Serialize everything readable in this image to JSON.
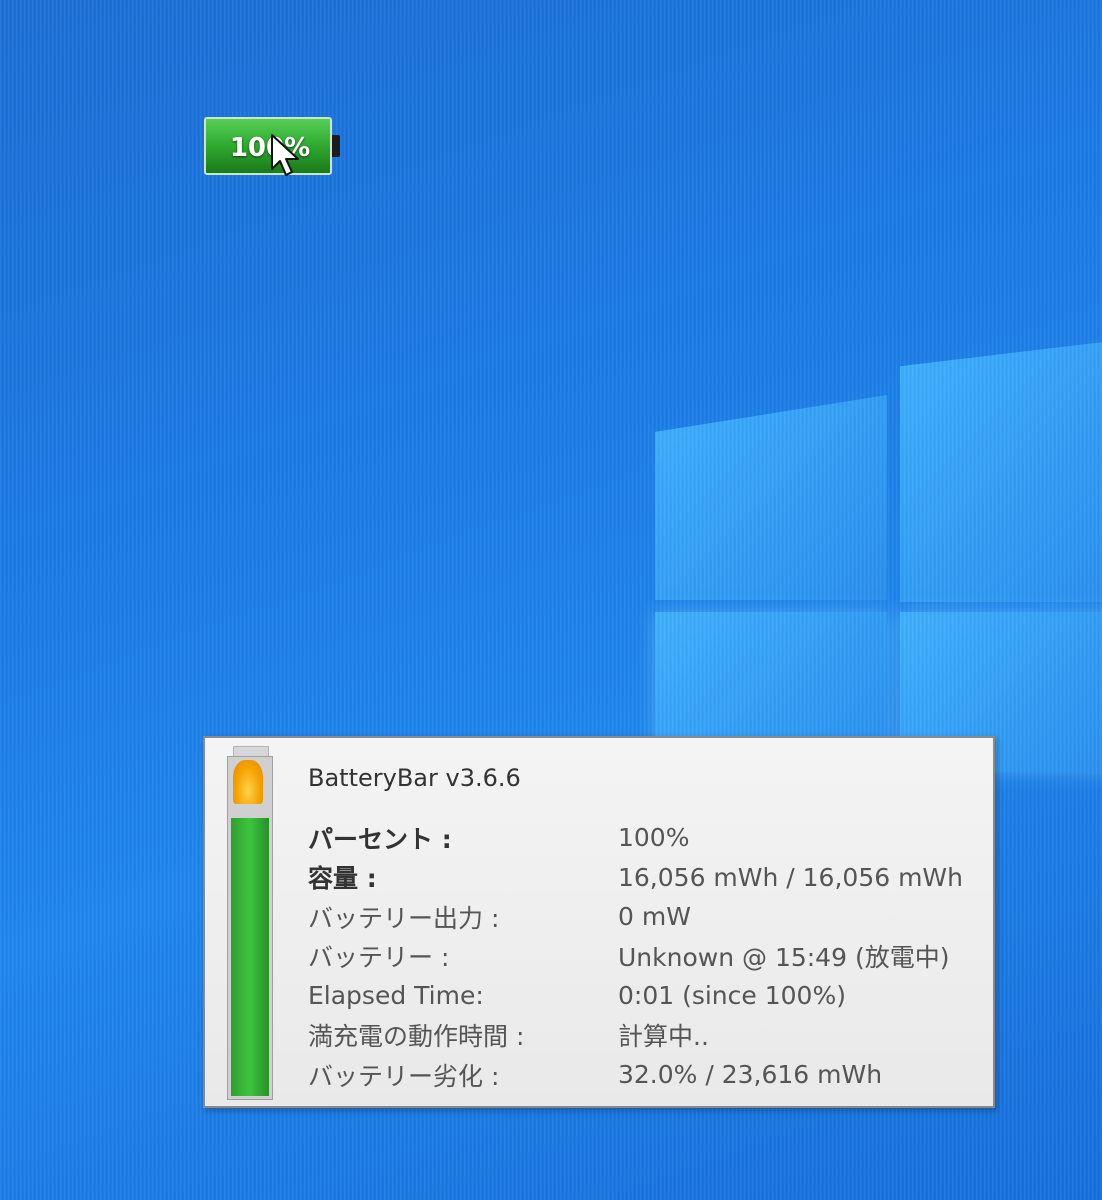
{
  "desktop_battery": {
    "percent_text": "100%",
    "level": 1.0
  },
  "tooltip": {
    "title": "BatteryBar v3.6.6",
    "rows": [
      {
        "label": "パーセント :",
        "value": "100%"
      },
      {
        "label": "容量 :",
        "value": "16,056 mWh / 16,056 mWh"
      },
      {
        "label": "バッテリー出力 :",
        "value": "0 mW"
      },
      {
        "label": "バッテリー :",
        "value": "Unknown @ 15:49 (放電中)"
      },
      {
        "label": "Elapsed Time:",
        "value": "0:01 (since 100%)"
      },
      {
        "label": "満充電の動作時間 :",
        "value": "計算中.."
      },
      {
        "label": "バッテリー劣化 :",
        "value": "32.0% / 23,616 mWh"
      }
    ],
    "battery_level": 1.0
  },
  "colors": {
    "desktop_blue": "#1a7be6",
    "battery_green": "#2aa02a",
    "tooltip_bg": "#f0f0f0"
  }
}
